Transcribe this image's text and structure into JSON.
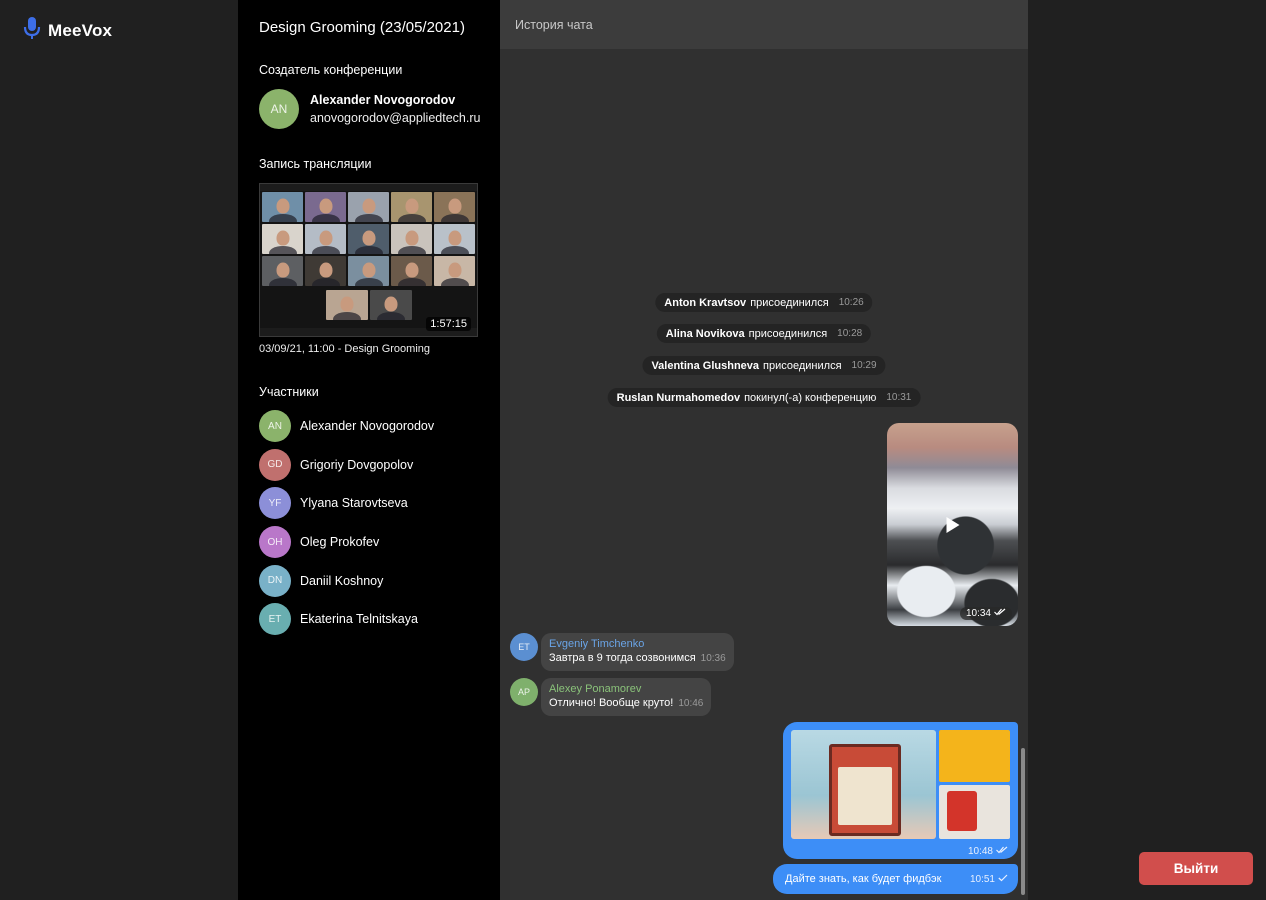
{
  "brand": {
    "name": "MeeVox",
    "accent": "#3d6ee8"
  },
  "conference": {
    "title": "Design Grooming (23/05/2021)",
    "creator_label": "Создатель конференции",
    "creator": {
      "initials": "AN",
      "name": "Alexander Novogorodov",
      "email": "anovogorodov@appliedtech.ru",
      "color": "#8bb36b"
    },
    "recording_label": "Запись трансляции",
    "recording": {
      "duration": "1:57:15",
      "caption": "03/09/21, 11:00 - Design Grooming"
    },
    "participants_label": "Участники",
    "participants": [
      {
        "initials": "AN",
        "name": "Alexander Novogorodov",
        "color": "#8bb36b"
      },
      {
        "initials": "GD",
        "name": "Grigoriy Dovgopolov",
        "color": "#c0706e"
      },
      {
        "initials": "YF",
        "name": "Ylyana Starovtseva",
        "color": "#8c8fd8"
      },
      {
        "initials": "OH",
        "name": "Oleg Prokofev",
        "color": "#b977c9"
      },
      {
        "initials": "DN",
        "name": "Daniil Koshnoy",
        "color": "#79b1c8"
      },
      {
        "initials": "ET",
        "name": "Ekaterina Telnitskaya",
        "color": "#69aeb0"
      }
    ]
  },
  "chat": {
    "header": "История чата",
    "system_messages": [
      {
        "who": "Anton Kravtsov",
        "what": "присоединился",
        "time": "10:26"
      },
      {
        "who": "Alina Novikova",
        "what": "присоединился",
        "time": "10:28"
      },
      {
        "who": "Valentina Glushneva",
        "what": "присоединился",
        "time": "10:29"
      },
      {
        "who": "Ruslan Nurmahomedov",
        "what": "покинул(-а) конференцию",
        "time": "10:31"
      }
    ],
    "video_message": {
      "time": "10:34",
      "status_icon": "double-check"
    },
    "incoming": [
      {
        "initials": "ET",
        "sender": "Evgeniy Timchenko",
        "sender_color": "#6aa4e6",
        "avatar_color": "#5b8fd1",
        "text": "Завтра в 9 тогда созвонимся",
        "time": "10:36"
      },
      {
        "initials": "AP",
        "sender": "Alexey Ponamorev",
        "sender_color": "#8ac27a",
        "avatar_color": "#7fb06c",
        "text": "Отлично! Вообще круто!",
        "time": "10:46"
      }
    ],
    "album_message": {
      "time": "10:48",
      "status_icon": "double-check"
    },
    "outgoing_text": {
      "text": "Дайте знать, как будет фидбэк",
      "time": "10:51",
      "status_icon": "check"
    }
  },
  "actions": {
    "exit_label": "Выйти",
    "exit_color": "#d14e4c"
  }
}
